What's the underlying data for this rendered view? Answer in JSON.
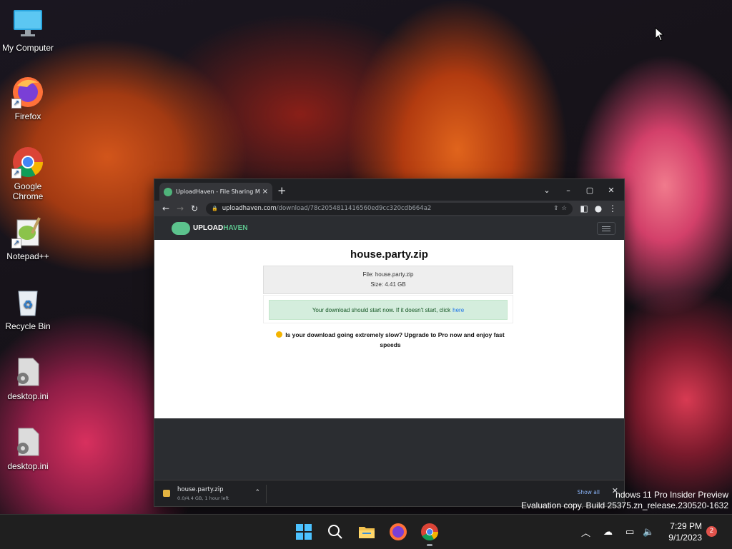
{
  "desktop": {
    "icons": [
      {
        "label": "My Computer",
        "icon": "monitor-icon"
      },
      {
        "label": "Firefox",
        "icon": "firefox-icon"
      },
      {
        "label": "Google Chrome",
        "icon": "chrome-icon"
      },
      {
        "label": "Notepad++",
        "icon": "notepadpp-icon"
      },
      {
        "label": "Recycle Bin",
        "icon": "recycle-bin-icon"
      },
      {
        "label": "desktop.ini",
        "icon": "settings-file-icon"
      },
      {
        "label": "desktop.ini",
        "icon": "settings-file-icon"
      }
    ],
    "watermark_line1": "ndows 11 Pro Insider Preview",
    "watermark_line2": "Evaluation copy. Build 25375.zn_release.230520-1632"
  },
  "browser": {
    "tab_title": "UploadHaven - File Sharing Mad",
    "tab_close": "×",
    "new_tab": "+",
    "window_controls": {
      "dropdown": "⌄",
      "minimize": "–",
      "maximize": "▢",
      "close": "✕"
    },
    "address": {
      "host": "uploadhaven.com",
      "path": "/download/78c2054811416560ed9cc320cdb664a2"
    }
  },
  "site": {
    "logo_prefix": "UPLOAD",
    "logo_suffix": "HAVEN",
    "heading": "house.party.zip",
    "file_line": "File: house.party.zip",
    "size_line": "Size: 4.41 GB",
    "notice_text": "Your download should start now. If it doesn't start, click",
    "notice_link": "here",
    "slow_text": "Is your download going extremely slow? Upgrade to Pro now and enjoy fast speeds"
  },
  "download_bar": {
    "file_name": "house.party.zip",
    "status": "0.0/4.4 GB, 1 hour left",
    "show_all": "Show all",
    "close": "✕"
  },
  "taskbar": {
    "time": "7:29 PM",
    "date": "9/1/2023",
    "notifications": "2"
  }
}
